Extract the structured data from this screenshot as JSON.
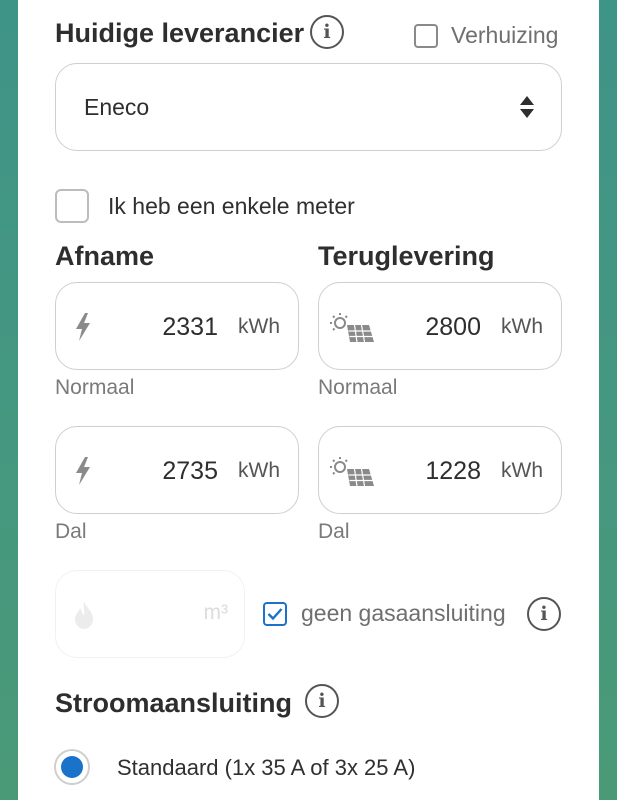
{
  "supplier": {
    "title": "Huidige leverancier",
    "info_icon": "i",
    "moving_label": "Verhuizing",
    "moving_checked": false,
    "selected": "Eneco"
  },
  "single_meter": {
    "label": "Ik heb een enkele meter",
    "checked": false
  },
  "consumption": {
    "title": "Afname",
    "normal": {
      "value": "2331",
      "unit": "kWh",
      "label": "Normaal"
    },
    "low": {
      "value": "2735",
      "unit": "kWh",
      "label": "Dal"
    }
  },
  "feed_in": {
    "title": "Teruglevering",
    "normal": {
      "value": "2800",
      "unit": "kWh",
      "label": "Normaal"
    },
    "low": {
      "value": "1228",
      "unit": "kWh",
      "label": "Dal"
    }
  },
  "gas": {
    "unit": "m³",
    "no_gas_label": "geen gasaansluiting",
    "no_gas_checked": true,
    "info_icon": "i"
  },
  "power_connection": {
    "title": "Stroomaansluiting",
    "info_icon": "i",
    "options": [
      {
        "label": "Standaard (1x 35 A of 3x 25 A)",
        "selected": true
      }
    ]
  },
  "colors": {
    "accent": "#1a73c9",
    "background": "#3f9488"
  }
}
